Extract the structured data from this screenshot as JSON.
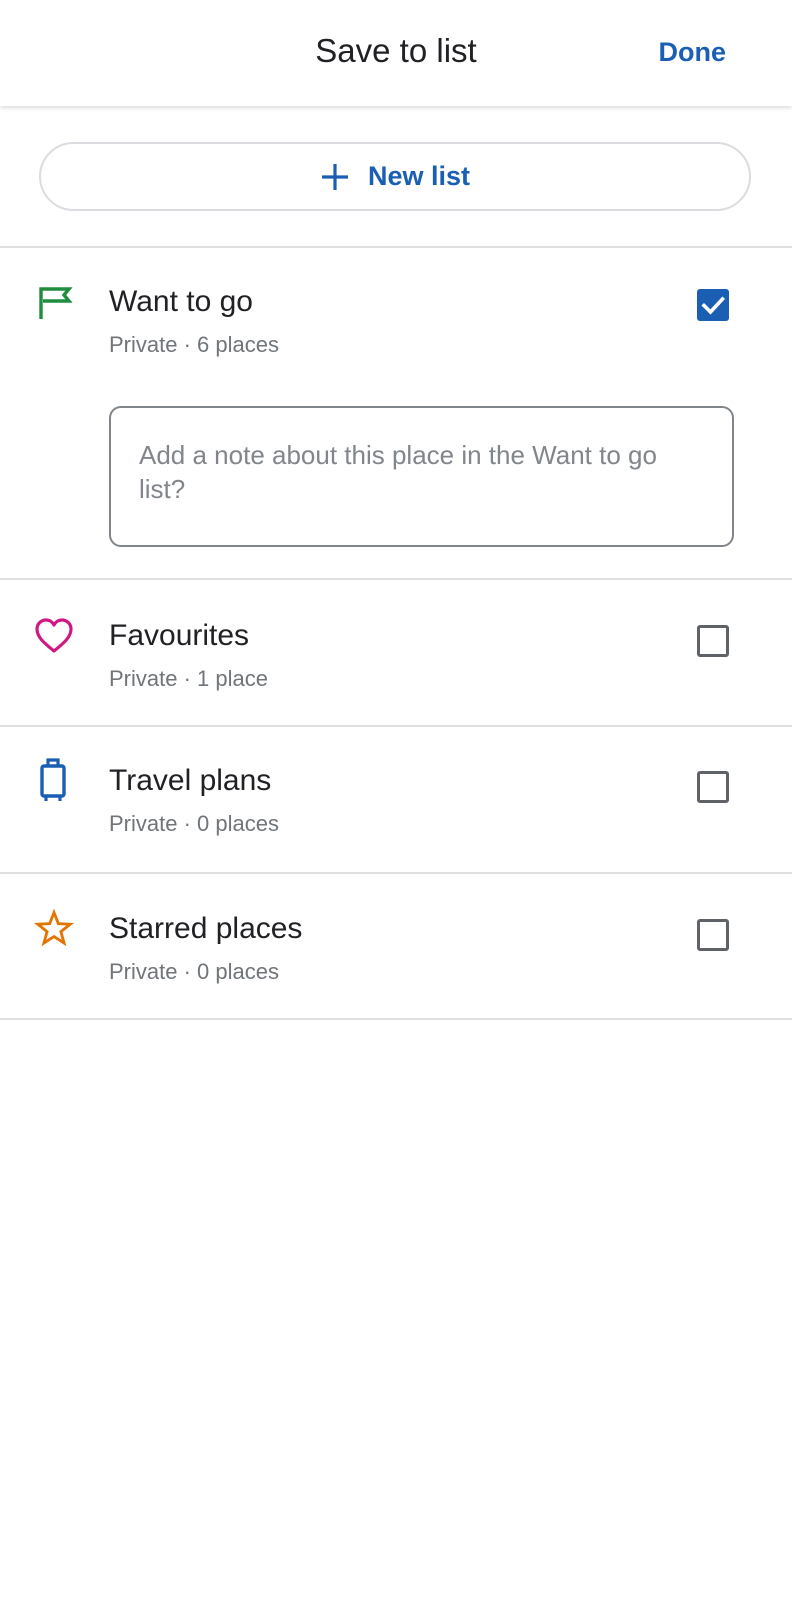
{
  "header": {
    "title": "Save to list",
    "done_label": "Done"
  },
  "new_list": {
    "label": "New list",
    "icon": "plus-icon"
  },
  "lists": [
    {
      "title": "Want to go",
      "subtitle": "Private · 6 places",
      "icon": "flag-icon",
      "icon_color": "#1e8e3e",
      "checked": true,
      "note_placeholder": "Add a note about this place in the Want to go list?"
    },
    {
      "title": "Favourites",
      "subtitle": "Private · 1 place",
      "icon": "heart-icon",
      "icon_color": "#d01884",
      "checked": false
    },
    {
      "title": "Travel plans",
      "subtitle": "Private · 0 places",
      "icon": "suitcase-icon",
      "icon_color": "#1a5fb4",
      "checked": false
    },
    {
      "title": "Starred places",
      "subtitle": "Private · 0 places",
      "icon": "star-icon",
      "icon_color": "#e37400",
      "checked": false
    }
  ],
  "colors": {
    "accent": "#1a5fb4",
    "divider": "#e0e0e0"
  }
}
